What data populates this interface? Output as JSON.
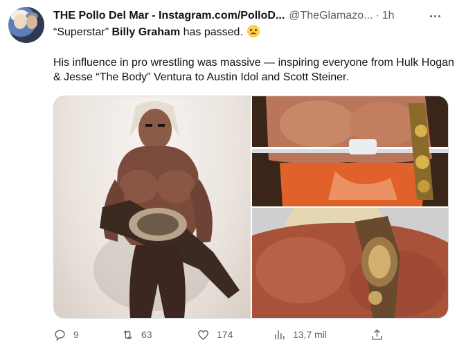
{
  "author": {
    "display_name": "THE Pollo Del Mar - Instagram.com/PolloD...",
    "handle": "@TheGlamazo...",
    "separator": "·",
    "time": "1h"
  },
  "tweet": {
    "line1_prefix": "“Superstar” ",
    "line1_bold": "Billy Graham",
    "line1_suffix": " has passed. ",
    "line1_emoji": "disappointed-face",
    "line2": "His influence in pro wrestling was massive — inspiring everyone from Hulk Hogan & Jesse “The Body” Ventura to Austin Idol and Scott Steiner."
  },
  "media": {
    "images": [
      "wrestler-with-belt-left",
      "wrestler-torso-ring-ropes",
      "wrestler-shoulder-belt"
    ]
  },
  "stats": {
    "replies": "9",
    "retweets": "63",
    "likes": "174",
    "views": "13,7 mil"
  },
  "icons": {
    "reply": "speech-bubble-icon",
    "retweet": "retweet-icon",
    "like": "heart-icon",
    "views": "bar-chart-icon",
    "share": "share-icon",
    "more": "more-dots-icon"
  },
  "colors": {
    "text": "#0f1419",
    "secondary": "#536471",
    "border": "#cfd9de"
  }
}
